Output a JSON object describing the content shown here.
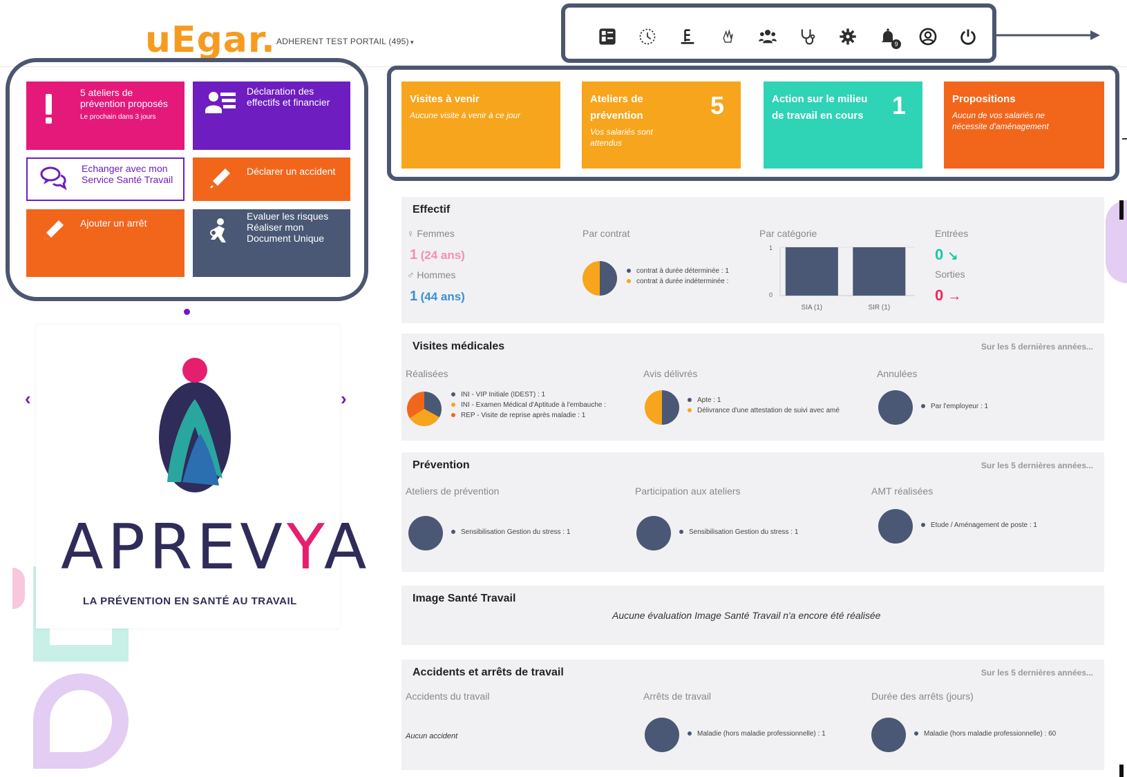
{
  "header": {
    "logo_text_u": "u",
    "logo_text_e": "E",
    "logo_text_gar": "gar.",
    "org_label": "ADHERENT TEST PORTAIL (495)",
    "org_caret": "▾",
    "toolbar_icons": [
      "dashboard-icon",
      "history-icon",
      "document-icon",
      "hand-icon",
      "users-icon",
      "stethoscope-icon",
      "gear-icon",
      "bell-icon",
      "user-icon",
      "power-icon"
    ],
    "notification_count": "9"
  },
  "quick_tiles": {
    "t1_title": "5 ateliers de prévention proposés",
    "t1_sub": "Le prochain dans 3 jours",
    "t2_title": "Déclaration des effectifs et financier",
    "t3_title": "Echanger avec mon Service Santé Travail",
    "t4_title": "Déclarer un accident",
    "t5_title": "Ajouter un arrêt",
    "t6_title": "Evaluer les risques Réaliser mon Document Unique"
  },
  "carousel": {
    "left_arrow": "‹",
    "right_arrow": "›",
    "brand_a": "APREV",
    "brand_y": "Y",
    "brand_end": "A",
    "brand_sub": "LA PRÉVENTION EN SANTÉ AU TRAVAIL"
  },
  "kpis": {
    "k1_title": "Visites à venir",
    "k1_sub": "Aucune visite à venir à ce jour",
    "k2_title": "Ateliers de prévention",
    "k2_num": "5",
    "k2_sub": "Vos salariés sont attendus",
    "k3_title": "Action sur le milieu de travail en cours",
    "k3_num": "1",
    "k4_title": "Propositions",
    "k4_sub": "Aucun de vos salariés ne nécessite d'aménagement"
  },
  "effectif": {
    "title": "Effectif",
    "femmes_label": "♀ Femmes",
    "femmes_count": "1",
    "femmes_age": "(24 ans)",
    "hommes_label": "♂ Hommes",
    "hommes_count": "1",
    "hommes_age": "(44 ans)",
    "contrat_label": "Par contrat",
    "contrat_legend_1": "contrat à durée déterminée : 1",
    "contrat_legend_2": "contrat à durée indéterminée :",
    "categorie_label": "Par catégorie",
    "entrees_label": "Entrées",
    "entrees_value": "0",
    "sorties_label": "Sorties",
    "sorties_value": "0",
    "chart_y_top": "1",
    "chart_y_bottom": "0"
  },
  "chart_data": {
    "type": "bar",
    "title": "Par catégorie",
    "categories": [
      "SIA (1)",
      "SIR (1)"
    ],
    "values": [
      1,
      1
    ],
    "ylim": [
      0,
      1
    ]
  },
  "visites": {
    "title": "Visites médicales",
    "note": "Sur les 5 dernières années...",
    "realisees": "Réalisées",
    "r1": "INI - VIP Initiale (IDEST) : 1",
    "r2": "INI - Examen Médical d'Aptitude à l'embauche :",
    "r3": "REP - Visite de reprise après maladie : 1",
    "avis": "Avis délivrés",
    "a1": "Apte : 1",
    "a2": "Délivrance d'une attestation de suivi avec amé",
    "annulees": "Annulées",
    "an1": "Par l'employeur : 1"
  },
  "prevention": {
    "title": "Prévention",
    "note": "Sur les 5 dernières années...",
    "ateliers": "Ateliers de prévention",
    "ateliers_l": "Sensibilisation Gestion du stress : 1",
    "participation": "Participation aux ateliers",
    "participation_l": "Sensibilisation Gestion du stress : 1",
    "amt": "AMT réalisées",
    "amt_l": "Etude / Aménagement de poste : 1"
  },
  "image_sante": {
    "title": "Image Santé Travail",
    "message": "Aucune évaluation Image Santé Travail n'a encore été réalisée"
  },
  "accidents": {
    "title": "Accidents et arrêts de travail",
    "note": "Sur les 5 dernières années...",
    "accidents_label": "Accidents du travail",
    "accidents_value": "Aucun accident",
    "arrets_label": "Arrêts de travail",
    "arrets_l": "Maladie (hors maladie professionnelle) : 1",
    "duree_label": "Durée des arrêts (jours)",
    "duree_l": "Maladie (hors maladie professionnelle) : 60"
  }
}
